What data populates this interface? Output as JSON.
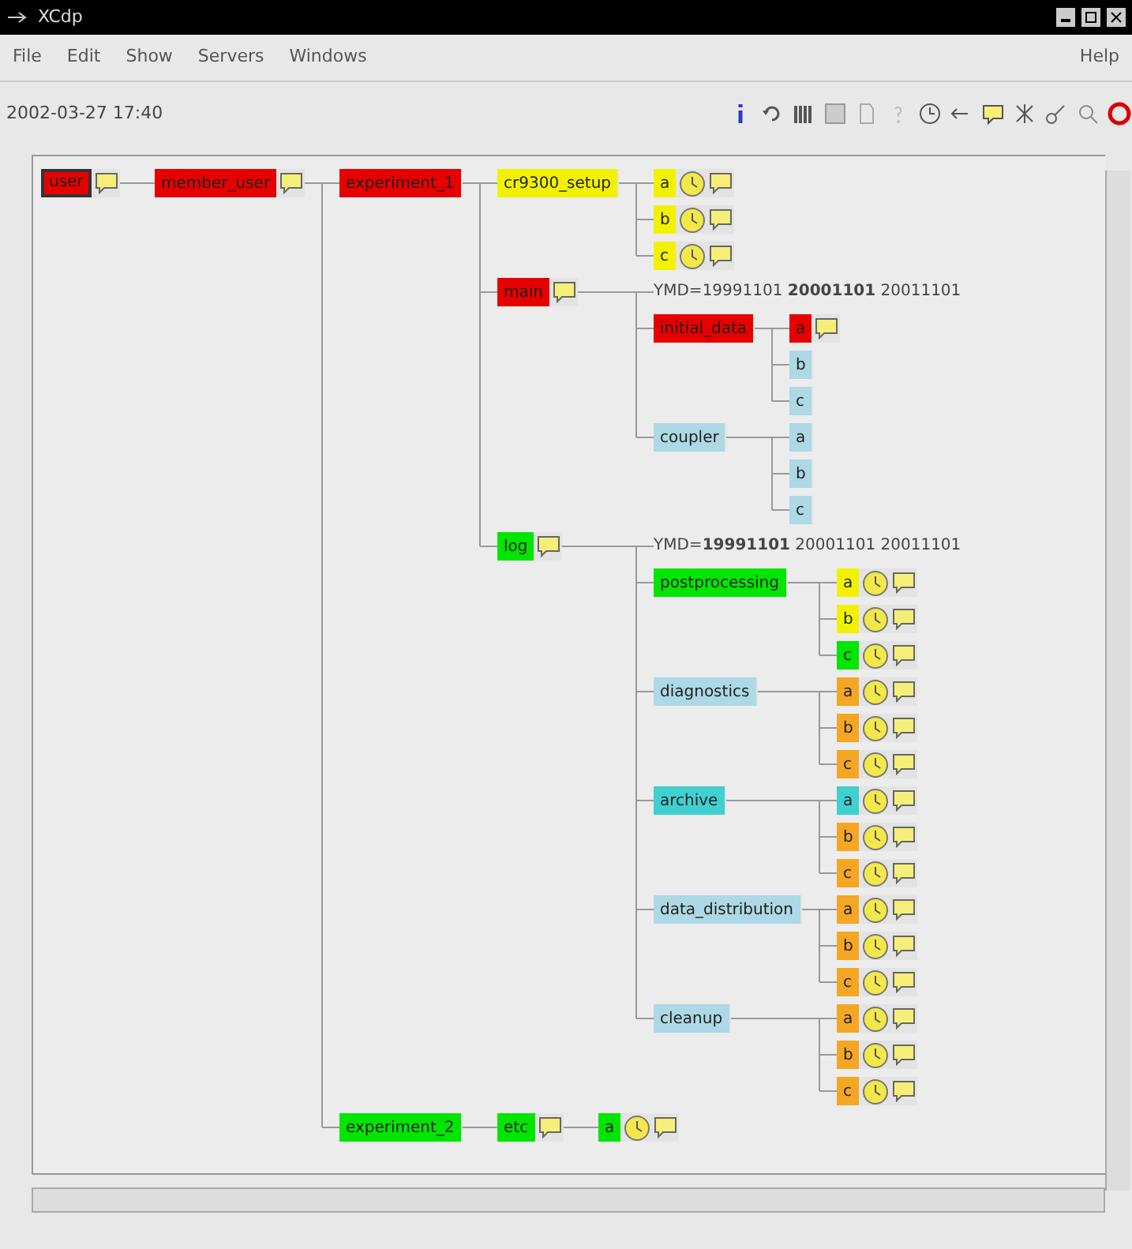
{
  "window": {
    "title": "XCdp"
  },
  "menu": [
    {
      "label": "File"
    },
    {
      "label": "Edit"
    },
    {
      "label": "Show"
    },
    {
      "label": "Servers"
    },
    {
      "label": "Windows"
    },
    {
      "label": "Help"
    }
  ],
  "toolbar": {
    "datetime": "2002-03-27 17:40"
  },
  "tree": [
    {
      "kind": "node",
      "label": "user",
      "color": "#e60000",
      "selected": true,
      "note": true,
      "clock": false,
      "children": [
        {
          "kind": "node",
          "label": "member_user",
          "color": "#e60000",
          "selected": false,
          "note": true,
          "clock": false,
          "children": [
            {
              "kind": "node",
              "label": "experiment_1",
              "color": "#e60000",
              "selected": false,
              "note": false,
              "clock": false,
              "children": [
                {
                  "kind": "node",
                  "label": "cr9300_setup",
                  "color": "#f2f200",
                  "selected": false,
                  "note": false,
                  "clock": false,
                  "children": [
                    {
                      "kind": "node",
                      "label": "a",
                      "color": "#f2f200",
                      "selected": false,
                      "note": true,
                      "clock": true
                    },
                    {
                      "kind": "node",
                      "label": "b",
                      "color": "#f2f200",
                      "selected": false,
                      "note": true,
                      "clock": true
                    },
                    {
                      "kind": "node",
                      "label": "c",
                      "color": "#f2f200",
                      "selected": false,
                      "note": true,
                      "clock": true
                    }
                  ]
                },
                {
                  "kind": "node",
                  "label": "main",
                  "color": "#e60000",
                  "selected": false,
                  "note": true,
                  "clock": false,
                  "children": [
                    {
                      "kind": "repeat",
                      "text": "YMD=19991101 **20001101** 20011101"
                    },
                    {
                      "kind": "node",
                      "label": "initial_data",
                      "color": "#e60000",
                      "selected": false,
                      "note": false,
                      "clock": false,
                      "children": [
                        {
                          "kind": "node",
                          "label": "a",
                          "color": "#e60000",
                          "selected": false,
                          "note": true,
                          "clock": false
                        },
                        {
                          "kind": "node",
                          "label": "b",
                          "color": "#add8e6",
                          "selected": false,
                          "note": false,
                          "clock": false
                        },
                        {
                          "kind": "node",
                          "label": "c",
                          "color": "#add8e6",
                          "selected": false,
                          "note": false,
                          "clock": false
                        }
                      ]
                    },
                    {
                      "kind": "node",
                      "label": "coupler",
                      "color": "#add8e6",
                      "selected": false,
                      "note": false,
                      "clock": false,
                      "children": [
                        {
                          "kind": "node",
                          "label": "a",
                          "color": "#add8e6",
                          "selected": false,
                          "note": false,
                          "clock": false
                        },
                        {
                          "kind": "node",
                          "label": "b",
                          "color": "#add8e6",
                          "selected": false,
                          "note": false,
                          "clock": false
                        },
                        {
                          "kind": "node",
                          "label": "c",
                          "color": "#add8e6",
                          "selected": false,
                          "note": false,
                          "clock": false
                        }
                      ]
                    }
                  ]
                },
                {
                  "kind": "node",
                  "label": "log",
                  "color": "#00e600",
                  "selected": false,
                  "note": true,
                  "clock": false,
                  "children": [
                    {
                      "kind": "repeat",
                      "text": "YMD=**19991101** 20001101 20011101"
                    },
                    {
                      "kind": "node",
                      "label": "postprocessing",
                      "color": "#00e600",
                      "selected": false,
                      "note": false,
                      "clock": false,
                      "children": [
                        {
                          "kind": "node",
                          "label": "a",
                          "color": "#f2f200",
                          "selected": false,
                          "note": true,
                          "clock": true
                        },
                        {
                          "kind": "node",
                          "label": "b",
                          "color": "#f2f200",
                          "selected": false,
                          "note": true,
                          "clock": true
                        },
                        {
                          "kind": "node",
                          "label": "c",
                          "color": "#00e600",
                          "selected": false,
                          "note": true,
                          "clock": true
                        }
                      ]
                    },
                    {
                      "kind": "node",
                      "label": "diagnostics",
                      "color": "#add8e6",
                      "selected": false,
                      "note": false,
                      "clock": false,
                      "children": [
                        {
                          "kind": "node",
                          "label": "a",
                          "color": "#f5a623",
                          "selected": false,
                          "note": true,
                          "clock": true
                        },
                        {
                          "kind": "node",
                          "label": "b",
                          "color": "#f5a623",
                          "selected": false,
                          "note": true,
                          "clock": true
                        },
                        {
                          "kind": "node",
                          "label": "c",
                          "color": "#f5a623",
                          "selected": false,
                          "note": true,
                          "clock": true
                        }
                      ]
                    },
                    {
                      "kind": "node",
                      "label": "archive",
                      "color": "#40d0d0",
                      "selected": false,
                      "note": false,
                      "clock": false,
                      "children": [
                        {
                          "kind": "node",
                          "label": "a",
                          "color": "#40d0d0",
                          "selected": false,
                          "note": true,
                          "clock": true
                        },
                        {
                          "kind": "node",
                          "label": "b",
                          "color": "#f5a623",
                          "selected": false,
                          "note": true,
                          "clock": true
                        },
                        {
                          "kind": "node",
                          "label": "c",
                          "color": "#f5a623",
                          "selected": false,
                          "note": true,
                          "clock": true
                        }
                      ]
                    },
                    {
                      "kind": "node",
                      "label": "data_distribution",
                      "color": "#add8e6",
                      "selected": false,
                      "note": false,
                      "clock": false,
                      "children": [
                        {
                          "kind": "node",
                          "label": "a",
                          "color": "#f5a623",
                          "selected": false,
                          "note": true,
                          "clock": true
                        },
                        {
                          "kind": "node",
                          "label": "b",
                          "color": "#f5a623",
                          "selected": false,
                          "note": true,
                          "clock": true
                        },
                        {
                          "kind": "node",
                          "label": "c",
                          "color": "#f5a623",
                          "selected": false,
                          "note": true,
                          "clock": true
                        }
                      ]
                    },
                    {
                      "kind": "node",
                      "label": "cleanup",
                      "color": "#add8e6",
                      "selected": false,
                      "note": false,
                      "clock": false,
                      "children": [
                        {
                          "kind": "node",
                          "label": "a",
                          "color": "#f5a623",
                          "selected": false,
                          "note": true,
                          "clock": true
                        },
                        {
                          "kind": "node",
                          "label": "b",
                          "color": "#f5a623",
                          "selected": false,
                          "note": true,
                          "clock": true
                        },
                        {
                          "kind": "node",
                          "label": "c",
                          "color": "#f5a623",
                          "selected": false,
                          "note": true,
                          "clock": true
                        }
                      ]
                    }
                  ]
                }
              ]
            },
            {
              "kind": "node",
              "label": "experiment_2",
              "color": "#00e600",
              "selected": false,
              "note": false,
              "clock": false,
              "children": [
                {
                  "kind": "node",
                  "label": "etc",
                  "color": "#00e600",
                  "selected": false,
                  "note": true,
                  "clock": false,
                  "children": [
                    {
                      "kind": "node",
                      "label": "a",
                      "color": "#00e600",
                      "selected": false,
                      "note": true,
                      "clock": true
                    }
                  ]
                }
              ]
            }
          ]
        }
      ]
    }
  ]
}
